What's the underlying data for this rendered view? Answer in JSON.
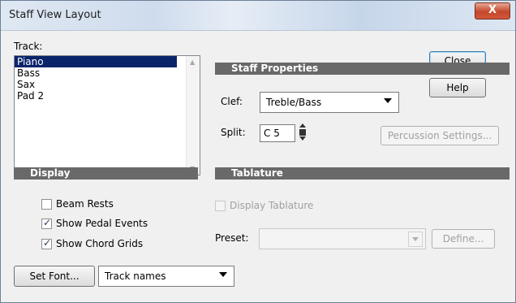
{
  "window": {
    "title": "Staff View Layout",
    "close_symbol": "X"
  },
  "track": {
    "label": "Track:",
    "items": [
      "Piano",
      "Bass",
      "Sax",
      "Pad 2"
    ],
    "selected_index": 0
  },
  "buttons": {
    "close": "Close",
    "help": "Help",
    "percussion": "Percussion Settings...",
    "set_font": "Set Font...",
    "define": "Define..."
  },
  "staff_properties": {
    "header": "Staff Properties",
    "clef_label": "Clef:",
    "clef_value": "Treble/Bass",
    "split_label": "Split:",
    "split_value": "C 5"
  },
  "display": {
    "header": "Display",
    "beam_rests": {
      "label": "Beam Rests",
      "checked": false
    },
    "show_pedal": {
      "label": "Show Pedal Events",
      "checked": true
    },
    "show_chord": {
      "label": "Show Chord Grids",
      "checked": true
    },
    "font_select_value": "Track names"
  },
  "tablature": {
    "header": "Tablature",
    "display_label": "Display Tablature",
    "display_checked": false,
    "preset_label": "Preset:",
    "preset_value": ""
  }
}
